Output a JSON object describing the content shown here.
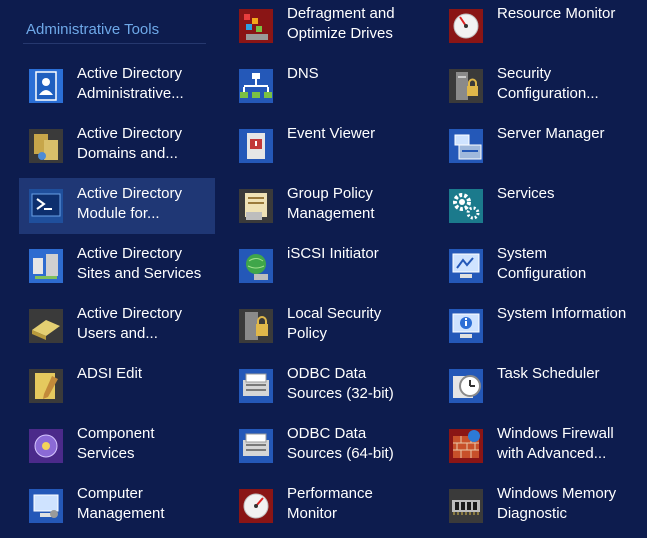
{
  "group": {
    "title": "Administrative Tools"
  },
  "tools": [
    {
      "id": "ad-admin-center",
      "line1": "Active Directory",
      "line2": "Administrative...",
      "icon": "ad-admin-center-icon"
    },
    {
      "id": "ad-domains-trusts",
      "line1": "Active Directory",
      "line2": "Domains and...",
      "icon": "ad-domains-icon"
    },
    {
      "id": "ad-powershell",
      "line1": "Active Directory",
      "line2": "Module for...",
      "icon": "powershell-icon",
      "selected": true
    },
    {
      "id": "ad-sites-services",
      "line1": "Active Directory",
      "line2": "Sites and Services",
      "icon": "ad-sites-icon"
    },
    {
      "id": "ad-users-computers",
      "line1": "Active Directory",
      "line2": "Users and...",
      "icon": "ad-users-icon"
    },
    {
      "id": "adsi-edit",
      "line1": "ADSI Edit",
      "line2": "",
      "icon": "adsi-edit-icon"
    },
    {
      "id": "component-services",
      "line1": "Component",
      "line2": "Services",
      "icon": "component-services-icon"
    },
    {
      "id": "computer-management",
      "line1": "Computer",
      "line2": "Management",
      "icon": "computer-management-icon"
    },
    {
      "id": "defragment",
      "line1": "Defragment and",
      "line2": "Optimize Drives",
      "icon": "defrag-icon"
    },
    {
      "id": "dns",
      "line1": "DNS",
      "line2": "",
      "icon": "dns-icon"
    },
    {
      "id": "event-viewer",
      "line1": "Event Viewer",
      "line2": "",
      "icon": "event-viewer-icon"
    },
    {
      "id": "group-policy",
      "line1": "Group Policy",
      "line2": "Management",
      "icon": "group-policy-icon"
    },
    {
      "id": "iscsi-initiator",
      "line1": "iSCSI Initiator",
      "line2": "",
      "icon": "iscsi-icon"
    },
    {
      "id": "local-security-policy",
      "line1": "Local Security",
      "line2": "Policy",
      "icon": "local-security-icon"
    },
    {
      "id": "odbc-32",
      "line1": "ODBC Data",
      "line2": "Sources (32-bit)",
      "icon": "odbc-icon"
    },
    {
      "id": "odbc-64",
      "line1": "ODBC Data",
      "line2": "Sources (64-bit)",
      "icon": "odbc-icon"
    },
    {
      "id": "performance-monitor",
      "line1": "Performance",
      "line2": "Monitor",
      "icon": "performance-monitor-icon"
    },
    {
      "id": "resource-monitor",
      "line1": "Resource Monitor",
      "line2": "",
      "icon": "resource-monitor-icon"
    },
    {
      "id": "security-configuration",
      "line1": "Security",
      "line2": "Configuration...",
      "icon": "security-config-icon"
    },
    {
      "id": "server-manager",
      "line1": "Server Manager",
      "line2": "",
      "icon": "server-manager-icon"
    },
    {
      "id": "services",
      "line1": "Services",
      "line2": "",
      "icon": "services-gear-icon"
    },
    {
      "id": "system-configuration",
      "line1": "System",
      "line2": "Configuration",
      "icon": "system-config-icon"
    },
    {
      "id": "system-information",
      "line1": "System Information",
      "line2": "",
      "icon": "system-info-icon"
    },
    {
      "id": "task-scheduler",
      "line1": "Task Scheduler",
      "line2": "",
      "icon": "task-scheduler-icon"
    },
    {
      "id": "windows-firewall",
      "line1": "Windows Firewall",
      "line2": "with Advanced...",
      "icon": "firewall-icon"
    },
    {
      "id": "windows-memory-diagnostic",
      "line1": "Windows Memory",
      "line2": "Diagnostic",
      "icon": "memory-diagnostic-icon"
    }
  ]
}
